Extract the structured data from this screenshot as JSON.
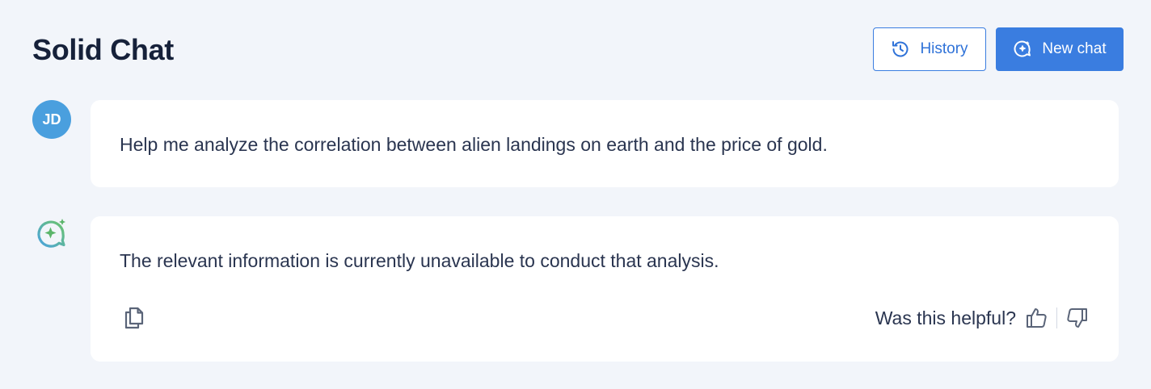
{
  "header": {
    "title": "Solid Chat",
    "history_label": "History",
    "new_chat_label": "New chat"
  },
  "user_message": {
    "avatar_initials": "JD",
    "text": "Help me analyze the correlation between alien landings on earth and the price of gold."
  },
  "assistant_message": {
    "text": "The relevant information is currently unavailable to conduct that analysis.",
    "feedback_prompt": "Was this helpful?"
  },
  "icons": {
    "history": "history-clock-icon",
    "new_chat": "sparkle-chat-icon",
    "assistant_avatar": "sparkle-chat-icon",
    "copy": "copy-icon",
    "thumbs_up": "thumbs-up-icon",
    "thumbs_down": "thumbs-down-icon"
  },
  "colors": {
    "primary": "#3a7de0",
    "user_avatar": "#4a9fde",
    "background": "#f2f5fa",
    "assistant_avatar_green": "#5bb56a"
  }
}
